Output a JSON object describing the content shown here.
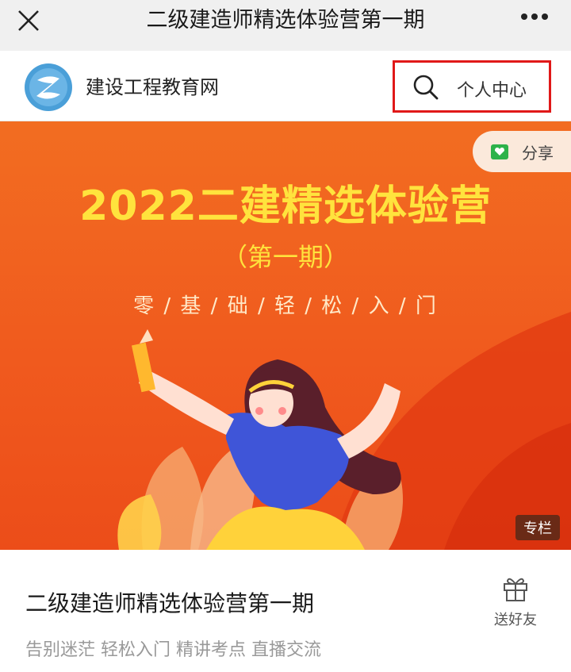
{
  "window": {
    "title": "二级建造师精选体验营第一期"
  },
  "header": {
    "site_name": "建设工程教育网",
    "personal_center": "个人中心"
  },
  "banner": {
    "share_label": "分享",
    "headline": "2022二建精选体验营",
    "period": "（第一期）",
    "slogan": "零 / 基 / 础 / 轻 / 松 / 入 / 门",
    "tag": "专栏"
  },
  "course": {
    "title": "二级建造师精选体验营第一期",
    "subtitle": "告别迷茫 轻松入门 精讲考点 直播交流",
    "gift_label": "送好友"
  },
  "colors": {
    "banner_orange": "#f05a1e",
    "headline_yellow": "#ffe33d",
    "highlight_red": "#e01818",
    "logo_blue": "#4a9fd8",
    "share_green": "#2db24a"
  },
  "icons": [
    "close-icon",
    "more-icon",
    "logo",
    "search-icon",
    "share-icon",
    "gift-icon"
  ]
}
